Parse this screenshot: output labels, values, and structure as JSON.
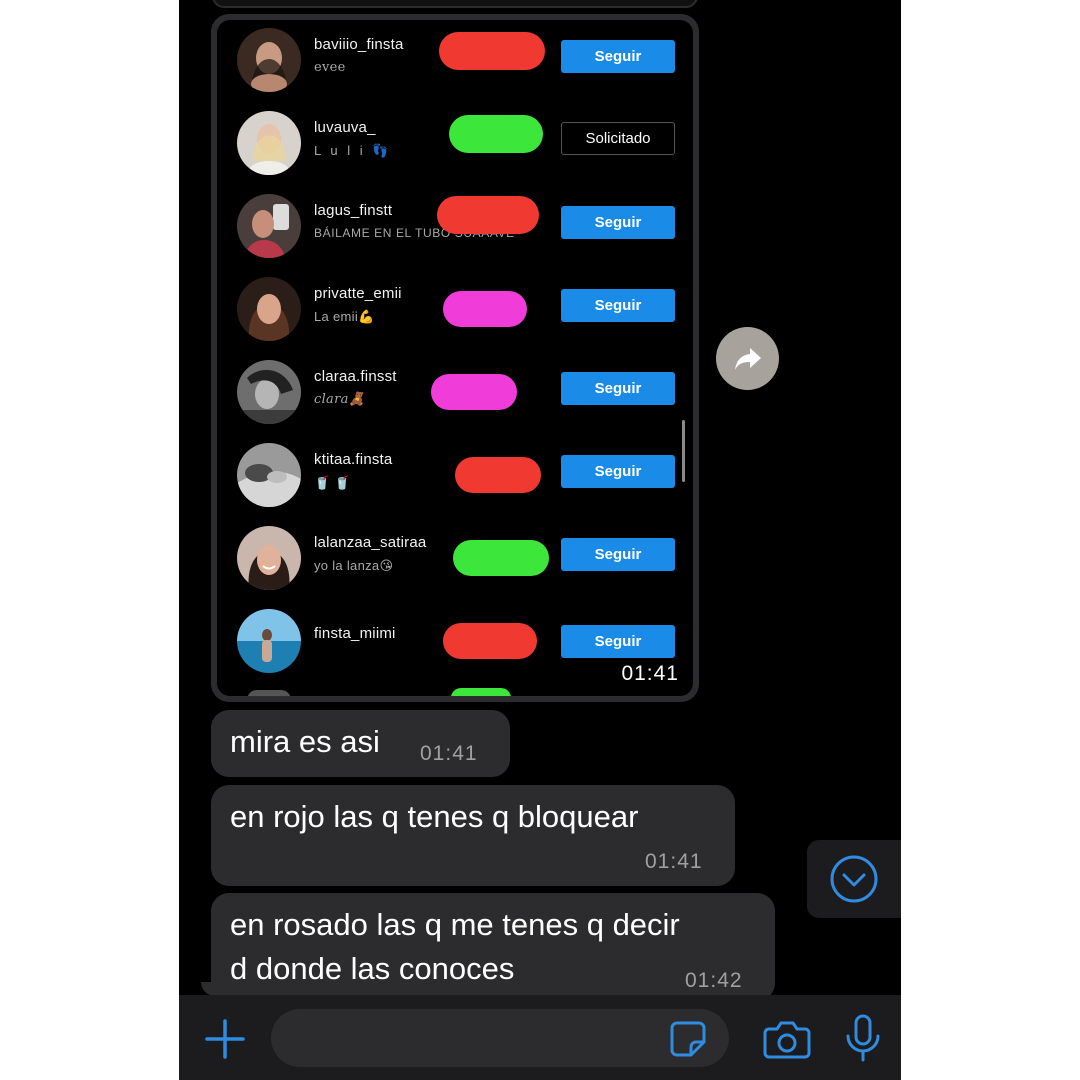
{
  "shared_screenshot": {
    "time": "01:41",
    "users": [
      {
        "username": "baviiio_finsta",
        "bio": "evee",
        "button": "Seguir",
        "marker": "red",
        "avatar": "avatar-dark-hair"
      },
      {
        "username": "luvauva_",
        "bio": "L u l i 👣",
        "button": "Solicitado",
        "marker": "green",
        "avatar": "avatar-blonde"
      },
      {
        "username": "lagus_finstt",
        "bio": "BÁILAME EN EL TUBO SUAAAVE",
        "button": "Seguir",
        "marker": "red",
        "avatar": "avatar-mirror-selfie"
      },
      {
        "username": "privatte_emii",
        "bio": "La emii💪",
        "button": "Seguir",
        "marker": "pink",
        "avatar": "avatar-brown-hair"
      },
      {
        "username": "claraa.finsst",
        "bio": "clara🧸",
        "button": "Seguir",
        "marker": "pink",
        "avatar": "avatar-bw"
      },
      {
        "username": "ktitaa.finsta",
        "bio": "🥤 🥤",
        "button": "Seguir",
        "marker": "red",
        "avatar": "avatar-bw-lying"
      },
      {
        "username": "lalanzaa_satiraa",
        "bio": "yo la lanza😘",
        "button": "Seguir",
        "marker": "green",
        "avatar": "avatar-smile"
      },
      {
        "username": "finsta_miimi",
        "bio": "",
        "button": "Seguir",
        "marker": "red",
        "avatar": "avatar-beach"
      }
    ]
  },
  "messages": [
    {
      "text": "mira es asi",
      "time": "01:41"
    },
    {
      "text": "en rojo las q tenes q bloquear",
      "time": "01:41"
    },
    {
      "text_line1": "en rosado las q me tenes q decir",
      "text_line2": "d donde las conoces",
      "time": "01:42"
    }
  ],
  "input": {
    "placeholder": ""
  },
  "colors": {
    "marker_red": "#f03a31",
    "marker_green": "#3de63a",
    "marker_pink": "#f03cd8",
    "follow_blue": "#1a8ce8",
    "bubble": "#2c2c2e",
    "accent": "#2f8ce0"
  },
  "icons": [
    "share-arrow-icon",
    "chevron-down-icon",
    "plus-icon",
    "sticker-icon",
    "camera-icon",
    "microphone-icon"
  ]
}
